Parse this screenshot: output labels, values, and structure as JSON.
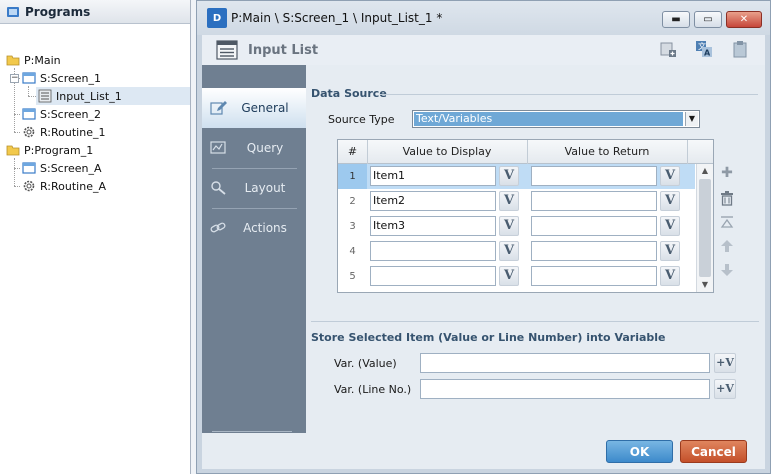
{
  "tree": {
    "header": "Programs",
    "items": [
      {
        "label": "P:Main",
        "icon": "folder-icon"
      },
      {
        "label": "S:Screen_1",
        "icon": "screen-icon"
      },
      {
        "label": "Input_List_1",
        "icon": "list-icon"
      },
      {
        "label": "S:Screen_2",
        "icon": "screen-icon"
      },
      {
        "label": "R:Routine_1",
        "icon": "gear-icon"
      },
      {
        "label": "P:Program_1",
        "icon": "folder-icon"
      },
      {
        "label": "S:Screen_A",
        "icon": "screen-icon"
      },
      {
        "label": "R:Routine_A",
        "icon": "gear-icon"
      }
    ]
  },
  "dialog": {
    "logo": "D",
    "title": "P:Main \\ S:Screen_1 \\ Input_List_1 *",
    "window_buttons": {
      "minimize": "▬",
      "restore": "▭",
      "close": "✕"
    },
    "toolbar_title": "Input List"
  },
  "nav": {
    "items": [
      {
        "label": "General",
        "icon": "pencil-icon",
        "active": true
      },
      {
        "label": "Query",
        "icon": "query-icon",
        "active": false
      },
      {
        "label": "Layout",
        "icon": "magnifier-icon",
        "active": false
      },
      {
        "label": "Actions",
        "icon": "chain-link-icon",
        "active": false
      }
    ]
  },
  "data_source": {
    "section_label": "Data Source",
    "source_type_label": "Source Type",
    "source_type_value": "Text/Variables",
    "table": {
      "columns": [
        "#",
        "Value to Display",
        "Value to Return"
      ],
      "v_label": "V",
      "rows": [
        {
          "num": "1",
          "display": "Item1",
          "return": ""
        },
        {
          "num": "2",
          "display": "Item2",
          "return": ""
        },
        {
          "num": "3",
          "display": "Item3",
          "return": ""
        },
        {
          "num": "4",
          "display": "",
          "return": ""
        },
        {
          "num": "5",
          "display": "",
          "return": ""
        }
      ]
    }
  },
  "store": {
    "section_label": "Store Selected Item (Value or Line Number) into Variable",
    "var_value_label": "Var. (Value)",
    "var_line_label": "Var. (Line No.)",
    "add_v_label": "+V"
  },
  "footer": {
    "ok": "OK",
    "cancel": "Cancel"
  },
  "colors": {
    "accent": "#3d8acb",
    "cancel": "#c4502a",
    "nav_bg": "#6f7f91",
    "selected_row": "#bfdcf5"
  }
}
